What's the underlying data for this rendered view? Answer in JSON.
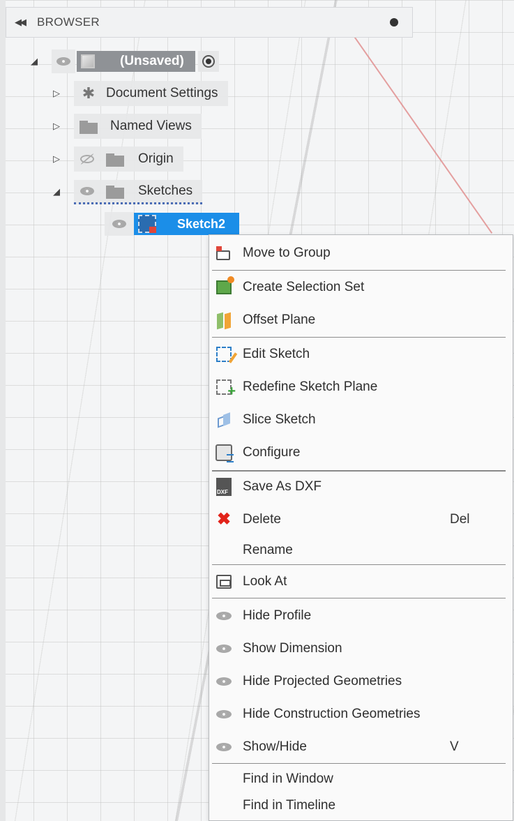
{
  "browser": {
    "title": "BROWSER",
    "collapse_icon": "double-chevron-left-icon",
    "pin_icon": "pin-dot-icon"
  },
  "tree": {
    "root": {
      "label": "(Unsaved)",
      "expanded": true
    },
    "items": [
      {
        "label": "Document Settings",
        "icon": "gear-icon",
        "expanded": false
      },
      {
        "label": "Named Views",
        "icon": "folder-icon",
        "expanded": false
      },
      {
        "label": "Origin",
        "icon": "folder-icon",
        "expanded": false,
        "visible": false
      },
      {
        "label": "Sketches",
        "icon": "folder-icon",
        "expanded": true
      }
    ],
    "selected": {
      "label": "Sketch2",
      "icon": "sketch-locked-icon"
    }
  },
  "context_menu": {
    "items": [
      {
        "label": "Move to Group",
        "icon": "move-to-group-icon"
      },
      {
        "label": "Create Selection Set",
        "icon": "selection-set-icon"
      },
      {
        "label": "Offset Plane",
        "icon": "offset-plane-icon"
      },
      {
        "label": "Edit Sketch",
        "icon": "edit-sketch-icon"
      },
      {
        "label": "Redefine Sketch Plane",
        "icon": "redefine-plane-icon"
      },
      {
        "label": "Slice Sketch",
        "icon": "slice-sketch-icon"
      },
      {
        "label": "Configure",
        "icon": "configure-icon"
      },
      {
        "label": "Save As DXF",
        "icon": "dxf-icon"
      },
      {
        "label": "Delete",
        "icon": "delete-x-icon",
        "shortcut": "Del"
      },
      {
        "label": "Rename"
      },
      {
        "label": "Look At",
        "icon": "look-at-icon"
      },
      {
        "label": "Hide Profile",
        "icon": "eye-icon"
      },
      {
        "label": "Show Dimension",
        "icon": "eye-icon"
      },
      {
        "label": "Hide Projected Geometries",
        "icon": "eye-icon"
      },
      {
        "label": "Hide Construction Geometries",
        "icon": "eye-icon"
      },
      {
        "label": "Show/Hide",
        "icon": "eye-icon",
        "shortcut": "V"
      },
      {
        "label": "Find in Window"
      },
      {
        "label": "Find in Timeline"
      }
    ]
  },
  "colors": {
    "selection": "#1b8ee8",
    "delete": "#e2231a",
    "grid_background": "#f4f5f6"
  }
}
